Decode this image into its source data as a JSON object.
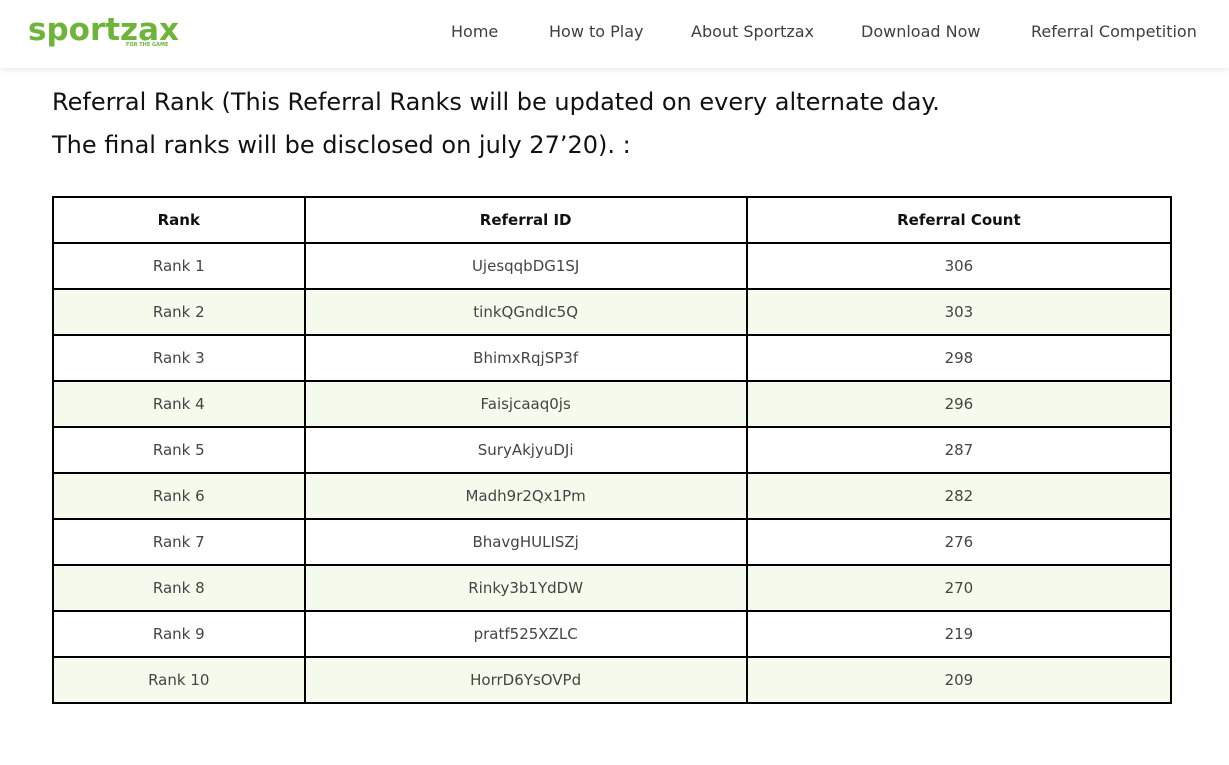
{
  "header": {
    "logo_text": "sportzax",
    "logo_tagline": "FOR THE GAME",
    "nav": [
      "Home",
      "How to Play",
      "About Sportzax",
      "Download Now",
      "Referral Competition"
    ]
  },
  "main": {
    "title_line1": "Referral Rank (This Referral Ranks will be updated on every alternate day.",
    "title_line2": "The final ranks will be disclosed on july 27’20). :",
    "table": {
      "headers": [
        "Rank",
        "Referral ID",
        "Referral Count"
      ],
      "rows": [
        [
          "Rank 1",
          "UjesqqbDG1SJ",
          "306"
        ],
        [
          "Rank 2",
          "tinkQGndIc5Q",
          "303"
        ],
        [
          "Rank 3",
          "BhimxRqjSP3f",
          "298"
        ],
        [
          "Rank 4",
          "Faisjcaaq0js",
          "296"
        ],
        [
          "Rank 5",
          "SuryAkjyuDJi",
          "287"
        ],
        [
          "Rank 6",
          "Madh9r2Qx1Pm",
          "282"
        ],
        [
          "Rank 7",
          "BhavgHULISZj",
          "276"
        ],
        [
          "Rank 8",
          "Rinky3b1YdDW",
          "270"
        ],
        [
          "Rank 9",
          "pratf525XZLC",
          "219"
        ],
        [
          "Rank 10",
          "HorrD6YsOVPd",
          "209"
        ]
      ]
    }
  },
  "colors": {
    "brand": "#6fb43a",
    "row_alt": "#f5fbec",
    "border": "#000000"
  }
}
